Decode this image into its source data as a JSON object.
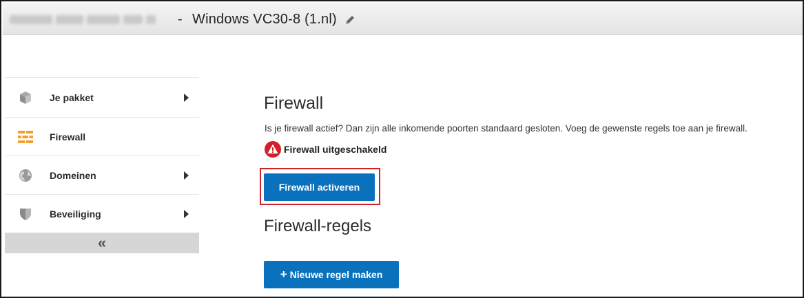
{
  "header": {
    "separator": "-",
    "title": "Windows VC30-8 (1.nl)",
    "edit_icon": "pencil-icon"
  },
  "sidebar": {
    "items": [
      {
        "label": "Je pakket",
        "icon": "package-icon",
        "has_submenu": true
      },
      {
        "label": "Firewall",
        "icon": "firewall-icon",
        "has_submenu": false
      },
      {
        "label": "Domeinen",
        "icon": "globe-icon",
        "has_submenu": true
      },
      {
        "label": "Beveiliging",
        "icon": "shield-icon",
        "has_submenu": true
      }
    ],
    "collapse_label": "«"
  },
  "main": {
    "heading": "Firewall",
    "description": "Is je firewall actief? Dan zijn alle inkomende poorten standaard gesloten. Voeg de gewenste regels toe aan je firewall.",
    "status_text": "Firewall uitgeschakeld",
    "activate_button": "Firewall activeren",
    "rules_heading": "Firewall-regels",
    "new_rule_plus": "+",
    "new_rule_button": "Nieuwe regel maken"
  },
  "colors": {
    "primary_button": "#0a72bd",
    "warning": "#d0202a",
    "firewall_icon": "#f0a030"
  }
}
